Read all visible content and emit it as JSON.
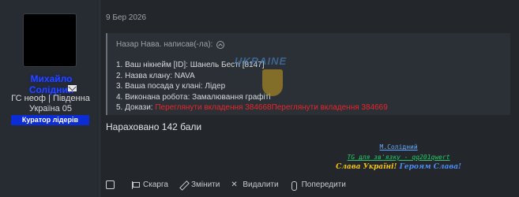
{
  "author": {
    "name": "Михайло Солідний",
    "title": "ГС неоф | Південна Україна 05",
    "role_badge": "Куратор лідерів",
    "mail_icon": "envelope-icon"
  },
  "post": {
    "date": "9 Бер 2026",
    "quote": {
      "header": "Назар Нава. написав(-ла):",
      "header_icon": "arrow-up-circle-icon",
      "items": [
        {
          "text": "1. Ваш нікнейм [ID]: Шанель Бесті [8147]"
        },
        {
          "text": "2. Назва клану: NAVA"
        },
        {
          "text": "3. Ваша посада у клані: Лідер"
        },
        {
          "text": "4. Виконана робота: Замалювання графіті"
        },
        {
          "prefix": "5. Докази: ",
          "link1": "Переглянути вкладення 384668",
          "link2": "Переглянути вкладення 384669"
        }
      ]
    },
    "watermark_text": "UKRAINE",
    "body": "Нараховано 142 бали",
    "signature": {
      "name": "М.Солідний",
      "contact": "TG для зв'язку - qq201qwert",
      "slogan_part1": "Слава Україні!",
      "slogan_part2": "Героям Слава!"
    }
  },
  "actions": {
    "report": "Скарга",
    "edit": "Змінити",
    "delete": "Видалити",
    "warn": "Попередити"
  },
  "colors": {
    "background": "#23272c",
    "username": "#2748ff",
    "badge": "#0c2cd6",
    "link_red": "#e8262a"
  }
}
